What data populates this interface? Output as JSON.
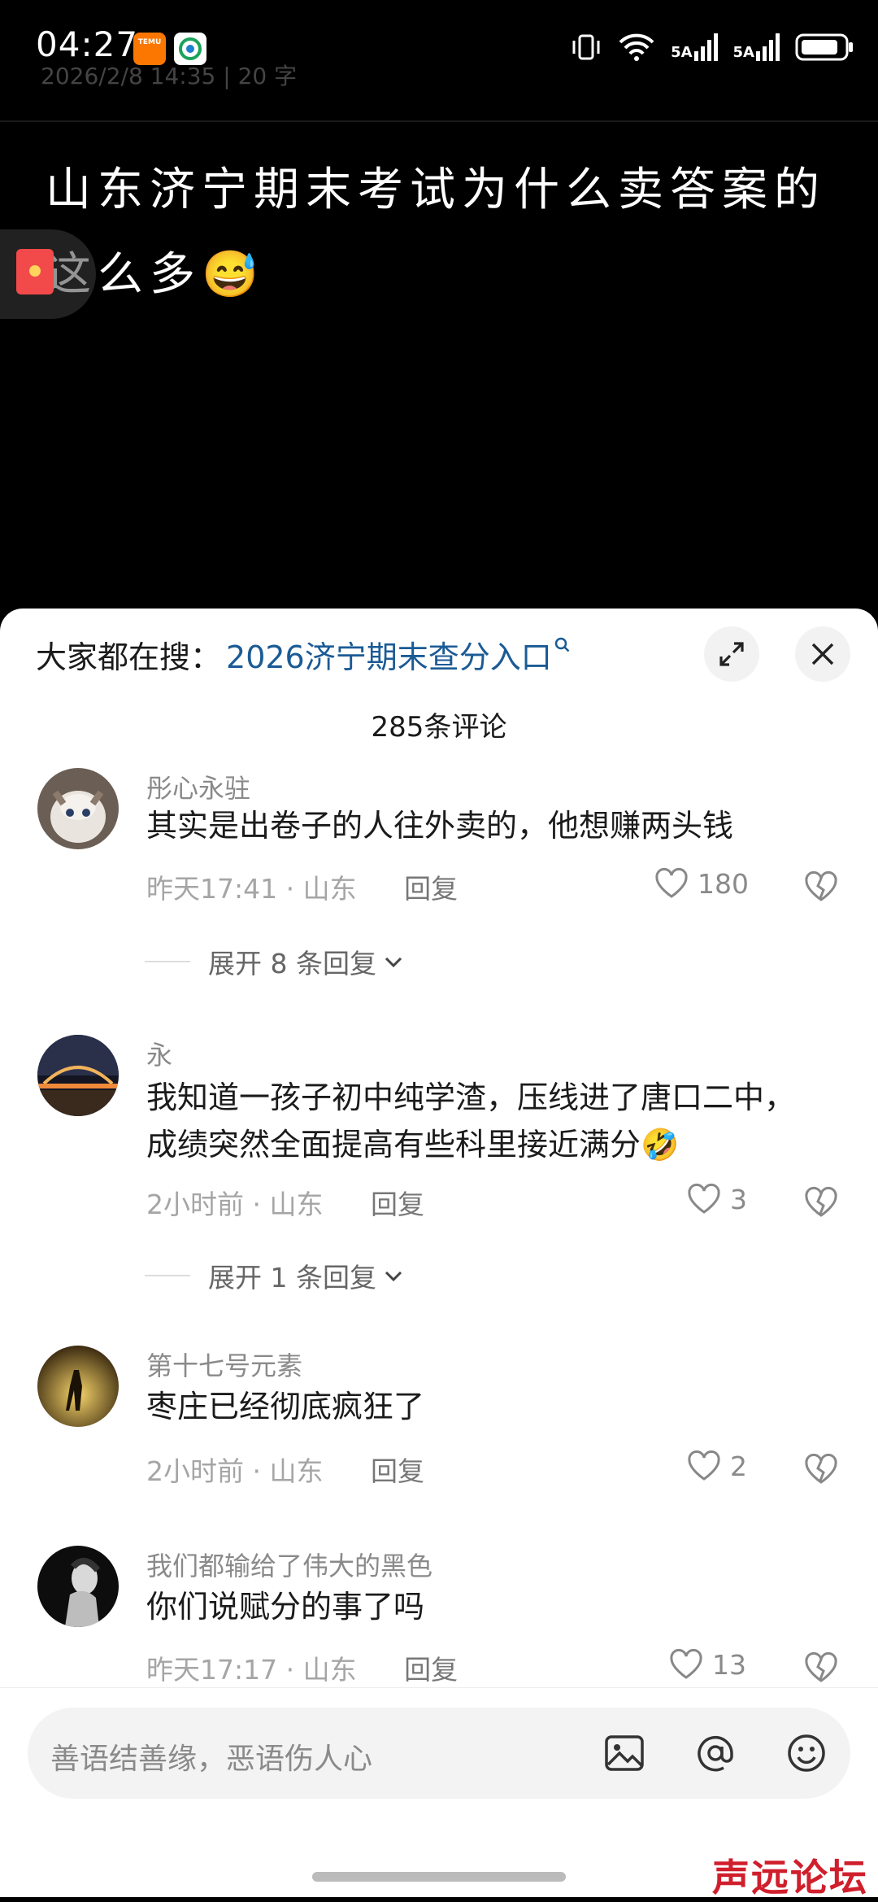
{
  "status_bar": {
    "time": "04:27",
    "signal_labels": [
      "5A",
      "5A"
    ],
    "app_icons": [
      "temu-icon",
      "china-mobile-icon"
    ],
    "temu_label": "TEMU"
  },
  "post": {
    "meta": "2026/2/8  14:35   |   20 字",
    "text": "山东济宁期末考试为什么卖答案的这么多😅"
  },
  "sheet": {
    "search_label": "大家都在搜：",
    "search_link": "2026济宁期末查分入口",
    "comment_count": "285条评论",
    "reply_label": "回复",
    "comments": [
      {
        "user": "彤心永驻",
        "text": "其实是出卷子的人往外卖的，他想赚两头钱",
        "meta": "昨天17:41 · 山东",
        "likes": "180",
        "expand": "展开 8 条回复"
      },
      {
        "user": "永",
        "text": "我知道一孩子初中纯学渣，压线进了唐口二中，成绩突然全面提高有些科里接近满分🤣",
        "meta": "2小时前 · 山东",
        "likes": "3",
        "expand": "展开 1 条回复"
      },
      {
        "user": "第十七号元素",
        "text": "枣庄已经彻底疯狂了",
        "meta": "2小时前 · 山东",
        "likes": "2"
      },
      {
        "user": "我们都输给了伟大的黑色",
        "text": "你们说赋分的事了吗",
        "meta": "昨天17:17 · 山东",
        "likes": "13"
      }
    ]
  },
  "input": {
    "placeholder": "善语结善缘，恶语伤人心"
  },
  "watermark": "声远论坛"
}
